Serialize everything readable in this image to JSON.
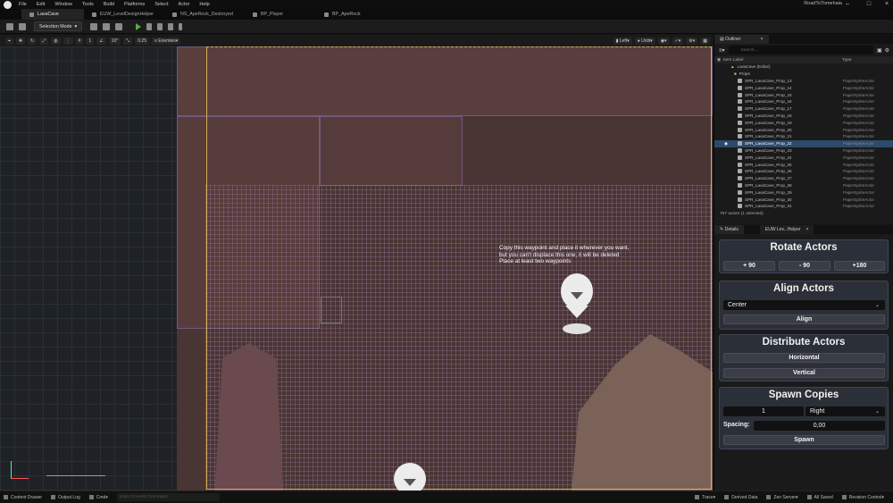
{
  "titlebar": {
    "menus": [
      "File",
      "Edit",
      "Window",
      "Tools",
      "Build",
      "Platforms",
      "Select",
      "Actor",
      "Help"
    ],
    "project": "RoadToTomehaia"
  },
  "tabs": [
    "LavaCave",
    "EUW_LevelDesignHelper",
    "NS_ApeRock_Destroyed",
    "BP_Player",
    "BP_ApeRock"
  ],
  "toolbar": {
    "mode": "Selection Mode"
  },
  "viewport_toolbar": {
    "snap_angle": "10°",
    "scale": "0.25",
    "layer": "Enemies",
    "view_mode": "Left",
    "lit": "Unlit"
  },
  "viewport": {
    "hint_lines": [
      "Copy this waypoint and place it wherever you want,",
      "but you can't displace this one, it will be deleted",
      "Place at least two waypoints"
    ]
  },
  "outliner": {
    "tab": "Outliner",
    "search_placeholder": "Search...",
    "col_label": "Item Label",
    "col_type": "Type",
    "root": "LavaCave (Editor)",
    "folder": "Props",
    "rows": [
      {
        "name": "SPR_LavaCave_Prop_13",
        "type": "PaperSpriteActor"
      },
      {
        "name": "SPR_LavaCave_Prop_14",
        "type": "PaperSpriteActor"
      },
      {
        "name": "SPR_LavaCave_Prop_15",
        "type": "PaperSpriteActor"
      },
      {
        "name": "SPR_LavaCave_Prop_16",
        "type": "PaperSpriteActor"
      },
      {
        "name": "SPR_LavaCave_Prop_17",
        "type": "PaperSpriteActor"
      },
      {
        "name": "SPR_LavaCave_Prop_18",
        "type": "PaperSpriteActor"
      },
      {
        "name": "SPR_LavaCave_Prop_19",
        "type": "PaperSpriteActor"
      },
      {
        "name": "SPR_LavaCave_Prop_20",
        "type": "PaperSpriteActor"
      },
      {
        "name": "SPR_LavaCave_Prop_21",
        "type": "PaperSpriteActor"
      },
      {
        "name": "SPR_LavaCave_Prop_22",
        "type": "PaperSpriteActor"
      },
      {
        "name": "SPR_LavaCave_Prop_23",
        "type": "PaperSpriteActor"
      },
      {
        "name": "SPR_LavaCave_Prop_24",
        "type": "PaperSpriteActor"
      },
      {
        "name": "SPR_LavaCave_Prop_25",
        "type": "PaperSpriteActor"
      },
      {
        "name": "SPR_LavaCave_Prop_26",
        "type": "PaperSpriteActor"
      },
      {
        "name": "SPR_LavaCave_Prop_27",
        "type": "PaperSpriteActor"
      },
      {
        "name": "SPR_LavaCave_Prop_28",
        "type": "PaperSpriteActor"
      },
      {
        "name": "SPR_LavaCave_Prop_29",
        "type": "PaperSpriteActor"
      },
      {
        "name": "SPR_LavaCave_Prop_30",
        "type": "PaperSpriteActor"
      },
      {
        "name": "SPR_LavaCave_Prop_31",
        "type": "PaperSpriteActor"
      }
    ],
    "selected_index": 9,
    "footer": "707 actors (1 selected)"
  },
  "details": {
    "tab": "Details",
    "helper_tab": "EUW Lev...Helper",
    "rotate": {
      "title": "Rotate Actors",
      "btn1": "+ 90",
      "btn2": "- 90",
      "btn3": "+180"
    },
    "align": {
      "title": "Align Actors",
      "option": "Center",
      "button": "Align"
    },
    "distribute": {
      "title": "Distribute Actors",
      "horizontal": "Horizontal",
      "vertical": "Vertical"
    },
    "spawn": {
      "title": "Spawn Copies",
      "count": "1",
      "direction": "Right",
      "spacing_label": "Spacing:",
      "spacing_value": "0,00",
      "button": "Spawn"
    }
  },
  "statusbar": {
    "content_drawer": "Content Drawer",
    "output_log": "Output Log",
    "cmd": "Cmd",
    "cmd_placeholder": "Enter Console Command",
    "trace": "Trace",
    "derived_data": "Derived Data",
    "zen_server": "Zen Server",
    "all_saved": "All Saved",
    "revision_control": "Revision Control"
  },
  "colors": {
    "selection": "#2d4a6a",
    "play_green": "#5aa845",
    "camera_frame": "#d8b050",
    "cave_rock": "#4a3535"
  }
}
